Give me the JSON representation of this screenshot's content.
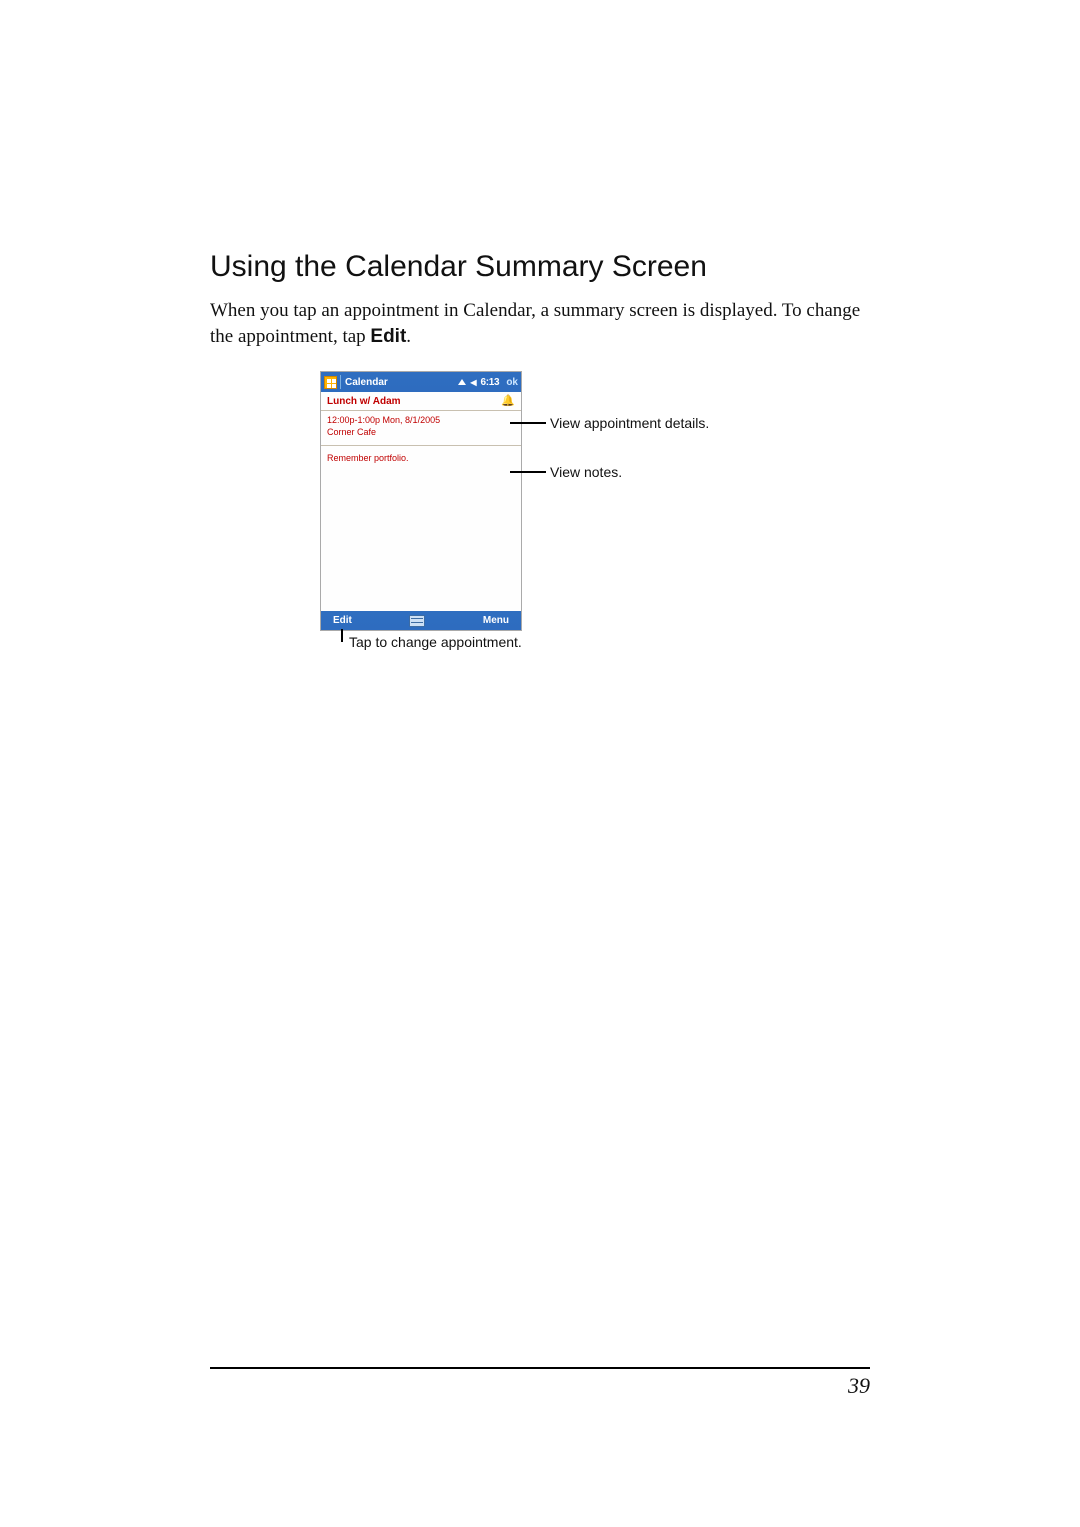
{
  "section": {
    "title": "Using the Calendar Summary Screen",
    "body_before_edit": "When you tap an appointment in Calendar, a summary screen is displayed. To change the appointment, tap ",
    "edit_label": "Edit",
    "body_after_edit": "."
  },
  "device": {
    "titlebar": {
      "app_title": "Calendar",
      "time": "6:13",
      "ok": "ok"
    },
    "appointment_title": "Lunch w/ Adam",
    "details_line1": "12:00p-1:00p Mon, 8/1/2005",
    "details_line2": "Corner Cafe",
    "notes": "Remember portfolio.",
    "softkeys": {
      "left": "Edit",
      "right": "Menu"
    }
  },
  "callouts": {
    "details": "View appointment details.",
    "notes": "View notes.",
    "edit": "Tap to change appointment."
  },
  "page_number": "39"
}
